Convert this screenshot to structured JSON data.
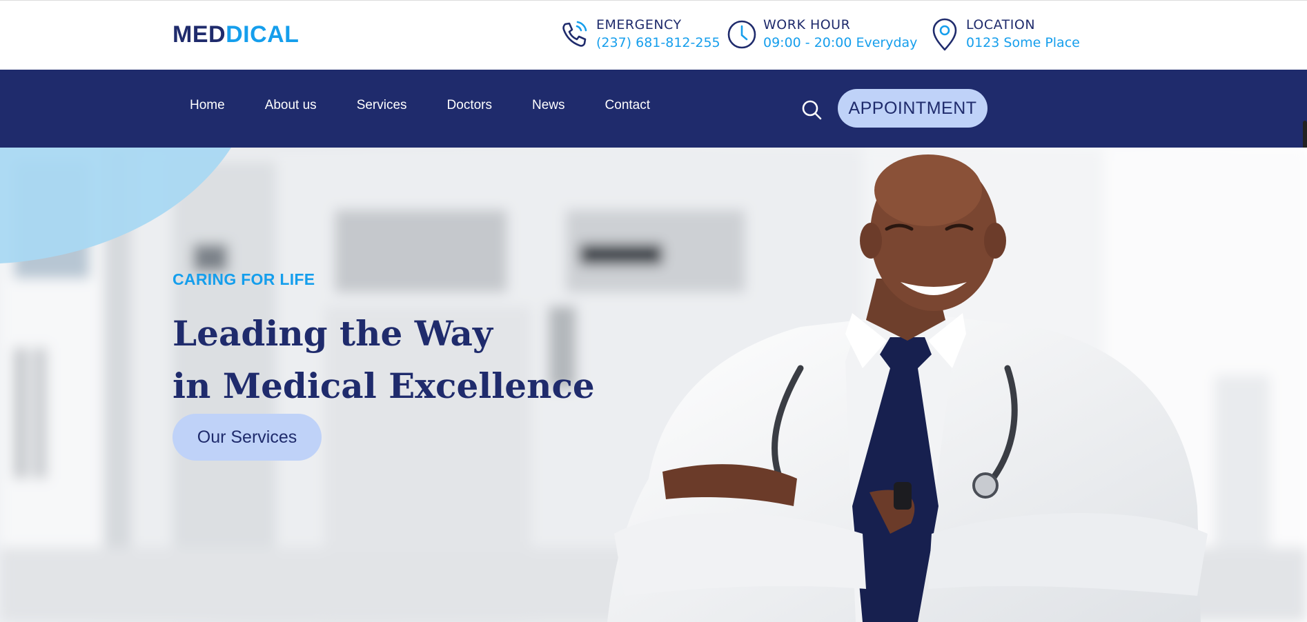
{
  "brand": {
    "part1": "MED",
    "part2": "DICAL"
  },
  "contact": [
    {
      "icon": "phone-icon",
      "label": "EMERGENCY",
      "value": "(237) 681-812-255"
    },
    {
      "icon": "clock-icon",
      "label": "WORK HOUR",
      "value": "09:00 - 20:00 Everyday"
    },
    {
      "icon": "location-pin-icon",
      "label": "LOCATION",
      "value": "0123 Some Place"
    }
  ],
  "nav": {
    "items": [
      "Home",
      "About us",
      "Services",
      "Doctors",
      "News",
      "Contact"
    ],
    "search_icon": "search-icon",
    "appointment_label": "APPOINTMENT"
  },
  "hero": {
    "eyebrow": "CARING FOR LIFE",
    "headline_line1": "Leading the Way",
    "headline_line2": "in Medical Excellence",
    "button_label": "Our Services",
    "image": "doctor-photo"
  },
  "colors": {
    "primary": "#1f2b6c",
    "accent": "#159eec",
    "button_bg": "#bfd2f8",
    "arc": "#a9d8f2"
  }
}
